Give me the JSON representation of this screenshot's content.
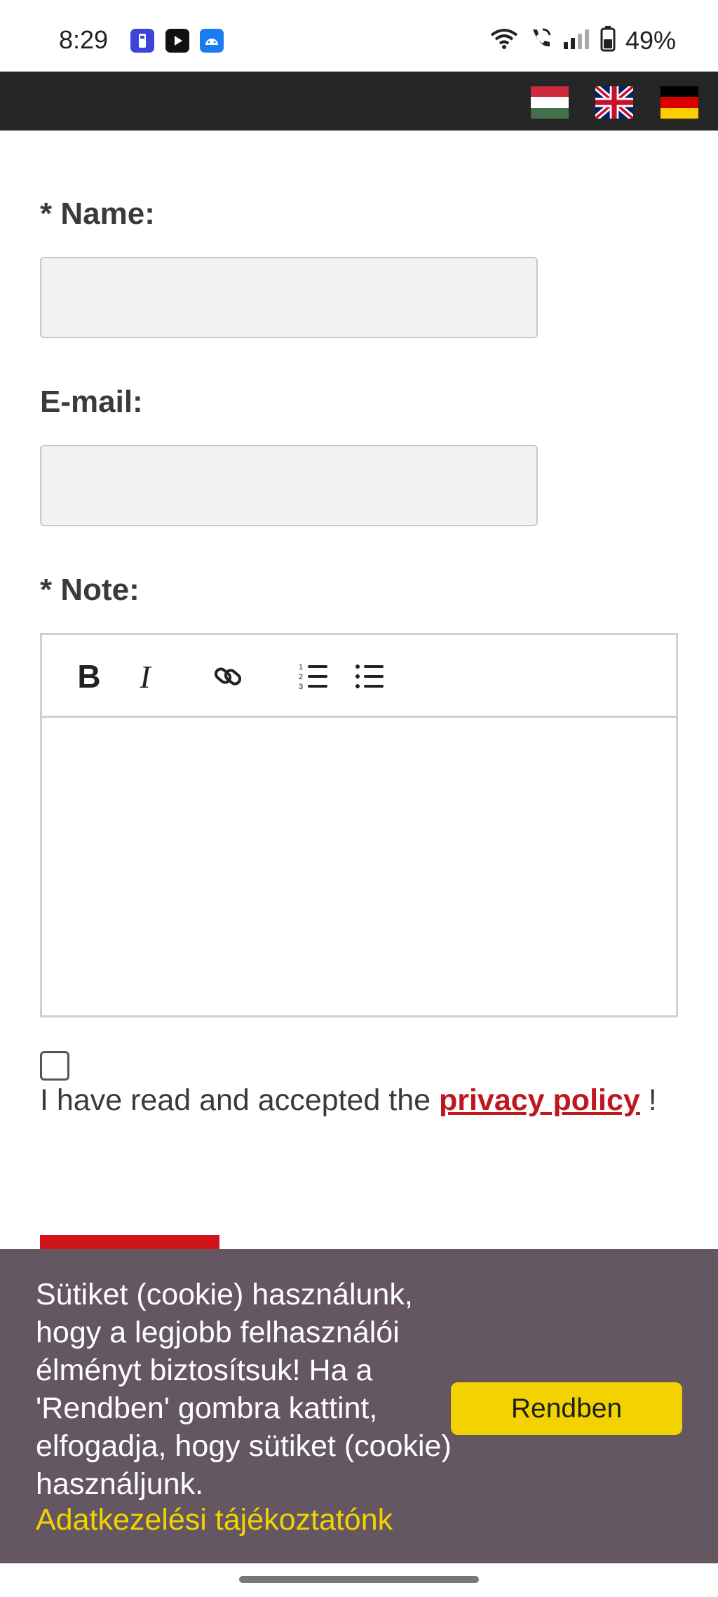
{
  "status_bar": {
    "time": "8:29",
    "apps": [
      "flashlight-app-icon",
      "youtube-app-icon",
      "android-app-icon"
    ],
    "icons": [
      "wifi-icon",
      "wifi-calling-icon",
      "signal-icon",
      "battery-icon"
    ],
    "battery_percent": "49%"
  },
  "language_flags": [
    {
      "name": "flag-hungarian",
      "colors": [
        "#cd2a3e",
        "#ffffff",
        "#436f4d"
      ]
    },
    {
      "name": "flag-english",
      "colors": [
        "#012169",
        "#ffffff",
        "#c8102e"
      ]
    },
    {
      "name": "flag-german",
      "colors": [
        "#000000",
        "#dd0000",
        "#ffce00"
      ]
    }
  ],
  "form": {
    "name_label": "* Name:",
    "name_value": "",
    "email_label": "E-mail:",
    "email_value": "",
    "note_label": "* Note:",
    "toolbar": {
      "bold": "B",
      "italic": "I",
      "link_icon": "link-icon",
      "ordered_list_icon": "ordered-list-icon",
      "bullet_list_icon": "bullet-list-icon"
    },
    "consent_prefix": "I have read and accepted the ",
    "privacy_link": "privacy policy",
    "consent_suffix": " !"
  },
  "cookie_banner": {
    "message": "Sütiket (cookie) használunk, hogy a legjobb felhasználói élményt biztosítsuk! Ha a 'Rendben' gombra kattint, elfogadja, hogy sütiket (cookie) használjunk.",
    "policy_link": "Adatkezelési tájékoztatónk",
    "accept_button": "Rendben"
  },
  "colors": {
    "nav_background": "#262626",
    "accent_red": "#d0141a",
    "banner_background": "#645761",
    "banner_yellow": "#f2d300"
  }
}
